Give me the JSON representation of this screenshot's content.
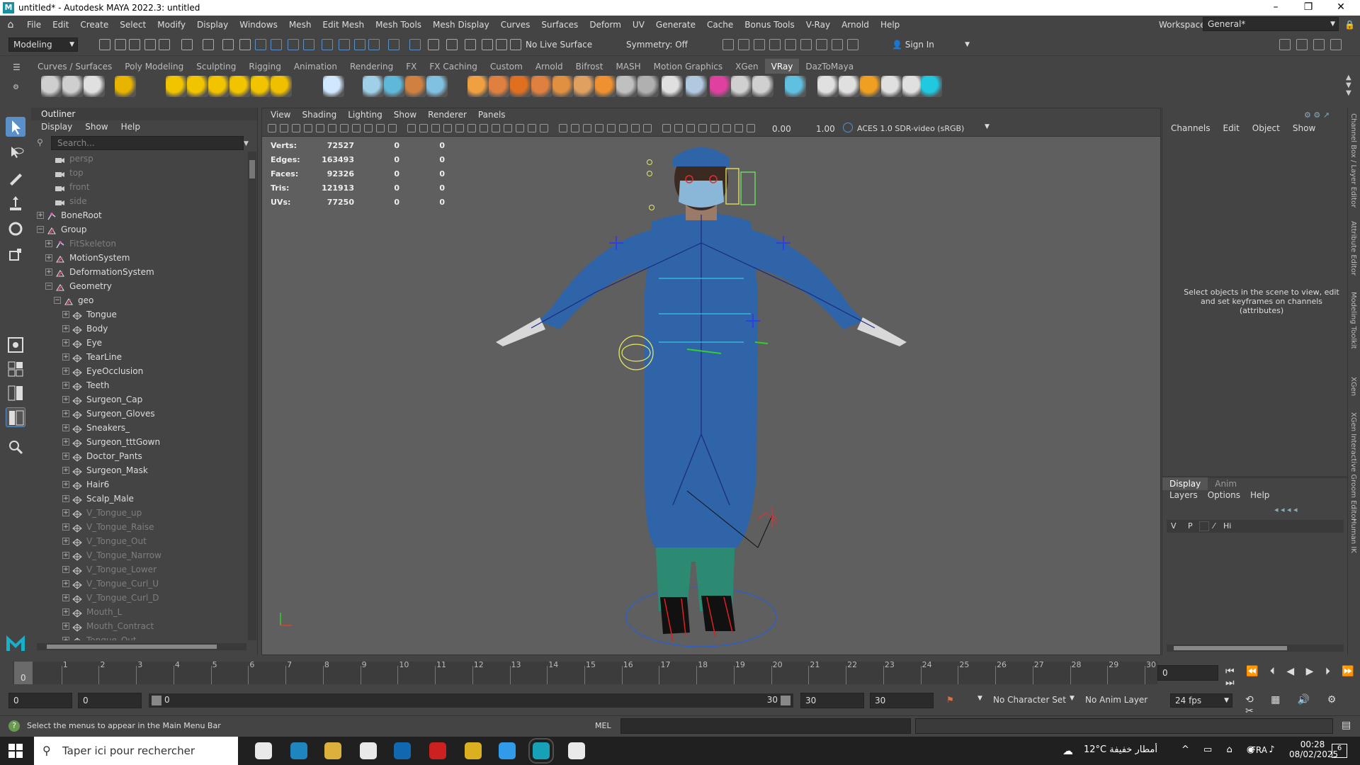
{
  "window": {
    "title": "untitled* - Autodesk MAYA 2022.3: untitled",
    "controls": [
      "–",
      "❐",
      "✕"
    ]
  },
  "menubar": {
    "items": [
      "File",
      "Edit",
      "Create",
      "Select",
      "Modify",
      "Display",
      "Windows",
      "Mesh",
      "Edit Mesh",
      "Mesh Tools",
      "Mesh Display",
      "Curves",
      "Surfaces",
      "Deform",
      "UV",
      "Generate",
      "Cache",
      "Bonus Tools",
      "V-Ray",
      "Arnold",
      "Help"
    ],
    "workspace_label": "Workspace:",
    "workspace_value": "General*"
  },
  "toolbar": {
    "mode": "Modeling",
    "live_surface": "No Live Surface",
    "symmetry": "Symmetry: Off",
    "sign_in": "Sign In"
  },
  "shelf": {
    "tabs": [
      "Curves / Surfaces",
      "Poly Modeling",
      "Sculpting",
      "Rigging",
      "Animation",
      "Rendering",
      "FX",
      "FX Caching",
      "Custom",
      "Arnold",
      "Bifrost",
      "MASH",
      "Motion Graphics",
      "XGen",
      "VRay",
      "DazToMaya"
    ],
    "active_tab": "VRay",
    "icon_colors": [
      "#cfcfcf",
      "#cfcfcf",
      "#e0e0e0",
      "#e8b400",
      "#f2c400",
      "#f2c400",
      "#f2c400",
      "#f2c400",
      "#f2c400",
      "#f0c000",
      "#d0e8ff",
      "#a0d0e8",
      "#60b8d8",
      "#d08040",
      "#80c0e0",
      "#f0a040",
      "#e08040",
      "#e07020",
      "#e08040",
      "#e09040",
      "#e0a060",
      "#f09030",
      "#c0c0c0",
      "#b0b0b0",
      "#e0e0e0",
      "#b0c8e0",
      "#e040a0",
      "#d0d0d0",
      "#d0d0d0",
      "#60c0e0",
      "#e0e0e0",
      "#e0e0e0",
      "#f0a020",
      "#e0e0e0",
      "#e0e0e0",
      "#20c8e0"
    ]
  },
  "outliner": {
    "title": "Outliner",
    "menus": [
      "Display",
      "Show",
      "Help"
    ],
    "search_placeholder": "Search...",
    "items": [
      {
        "label": "persp",
        "level": 1,
        "dim": true,
        "icon": "camera-icon",
        "expand": ""
      },
      {
        "label": "top",
        "level": 1,
        "dim": true,
        "icon": "camera-icon",
        "expand": ""
      },
      {
        "label": "front",
        "level": 1,
        "dim": true,
        "icon": "camera-icon",
        "expand": ""
      },
      {
        "label": "side",
        "level": 1,
        "dim": true,
        "icon": "camera-icon",
        "expand": ""
      },
      {
        "label": "BoneRoot",
        "level": 0,
        "dim": false,
        "icon": "joint-icon",
        "expand": "+"
      },
      {
        "label": "Group",
        "level": 0,
        "dim": false,
        "icon": "group-icon",
        "expand": "−"
      },
      {
        "label": "FitSkeleton",
        "level": 1,
        "dim": true,
        "icon": "joint-icon",
        "expand": "+"
      },
      {
        "label": "MotionSystem",
        "level": 1,
        "dim": false,
        "icon": "group-icon",
        "expand": "+"
      },
      {
        "label": "DeformationSystem",
        "level": 1,
        "dim": false,
        "icon": "group-icon",
        "expand": "+"
      },
      {
        "label": "Geometry",
        "level": 1,
        "dim": false,
        "icon": "group-icon",
        "expand": "−"
      },
      {
        "label": "geo",
        "level": 2,
        "dim": false,
        "icon": "group-icon",
        "expand": "−"
      },
      {
        "label": "Tongue",
        "level": 3,
        "dim": false,
        "icon": "mesh-icon",
        "expand": "+"
      },
      {
        "label": "Body",
        "level": 3,
        "dim": false,
        "icon": "mesh-icon",
        "expand": "+"
      },
      {
        "label": "Eye",
        "level": 3,
        "dim": false,
        "icon": "mesh-icon",
        "expand": "+"
      },
      {
        "label": "TearLine",
        "level": 3,
        "dim": false,
        "icon": "mesh-icon",
        "expand": "+"
      },
      {
        "label": "EyeOcclusion",
        "level": 3,
        "dim": false,
        "icon": "mesh-icon",
        "expand": "+"
      },
      {
        "label": "Teeth",
        "level": 3,
        "dim": false,
        "icon": "mesh-icon",
        "expand": "+"
      },
      {
        "label": "Surgeon_Cap",
        "level": 3,
        "dim": false,
        "icon": "mesh-icon",
        "expand": "+"
      },
      {
        "label": "Surgeon_Gloves",
        "level": 3,
        "dim": false,
        "icon": "mesh-icon",
        "expand": "+"
      },
      {
        "label": "Sneakers_",
        "level": 3,
        "dim": false,
        "icon": "mesh-icon",
        "expand": "+"
      },
      {
        "label": "Surgeon_tttGown",
        "level": 3,
        "dim": false,
        "icon": "mesh-icon",
        "expand": "+"
      },
      {
        "label": "Doctor_Pants",
        "level": 3,
        "dim": false,
        "icon": "mesh-icon",
        "expand": "+"
      },
      {
        "label": "Surgeon_Mask",
        "level": 3,
        "dim": false,
        "icon": "mesh-icon",
        "expand": "+"
      },
      {
        "label": "Hair6",
        "level": 3,
        "dim": false,
        "icon": "mesh-icon",
        "expand": "+"
      },
      {
        "label": "Scalp_Male",
        "level": 3,
        "dim": false,
        "icon": "mesh-icon",
        "expand": "+"
      },
      {
        "label": "V_Tongue_up",
        "level": 3,
        "dim": true,
        "icon": "mesh-icon",
        "expand": "+"
      },
      {
        "label": "V_Tongue_Raise",
        "level": 3,
        "dim": true,
        "icon": "mesh-icon",
        "expand": "+"
      },
      {
        "label": "V_Tongue_Out",
        "level": 3,
        "dim": true,
        "icon": "mesh-icon",
        "expand": "+"
      },
      {
        "label": "V_Tongue_Narrow",
        "level": 3,
        "dim": true,
        "icon": "mesh-icon",
        "expand": "+"
      },
      {
        "label": "V_Tongue_Lower",
        "level": 3,
        "dim": true,
        "icon": "mesh-icon",
        "expand": "+"
      },
      {
        "label": "V_Tongue_Curl_U",
        "level": 3,
        "dim": true,
        "icon": "mesh-icon",
        "expand": "+"
      },
      {
        "label": "V_Tongue_Curl_D",
        "level": 3,
        "dim": true,
        "icon": "mesh-icon",
        "expand": "+"
      },
      {
        "label": "Mouth_L",
        "level": 3,
        "dim": true,
        "icon": "mesh-icon",
        "expand": "+"
      },
      {
        "label": "Mouth_Contract",
        "level": 3,
        "dim": true,
        "icon": "mesh-icon",
        "expand": "+"
      },
      {
        "label": "Tongue_Out",
        "level": 3,
        "dim": true,
        "icon": "mesh-icon",
        "expand": "+"
      }
    ]
  },
  "viewport": {
    "menus": [
      "View",
      "Shading",
      "Lighting",
      "Show",
      "Renderer",
      "Panels"
    ],
    "exposure": "0.00",
    "gamma": "1.00",
    "color_space": "ACES 1.0 SDR-video (sRGB)",
    "stats": [
      {
        "label": "Verts:",
        "v1": "72527",
        "v2": "0",
        "v3": "0"
      },
      {
        "label": "Edges:",
        "v1": "163493",
        "v2": "0",
        "v3": "0"
      },
      {
        "label": "Faces:",
        "v1": "92326",
        "v2": "0",
        "v3": "0"
      },
      {
        "label": "Tris:",
        "v1": "121913",
        "v2": "0",
        "v3": "0"
      },
      {
        "label": "UVs:",
        "v1": "77250",
        "v2": "0",
        "v3": "0"
      }
    ]
  },
  "channelbox": {
    "menus": [
      "Channels",
      "Edit",
      "Object",
      "Show"
    ],
    "hint": "Select objects in the scene to view, edit and set keyframes on channels (attributes)",
    "layer_tabs": [
      "Display",
      "Anim"
    ],
    "layer_menus": [
      "Layers",
      "Options",
      "Help"
    ],
    "layer_cols": [
      "V",
      "P",
      "",
      "Hi"
    ]
  },
  "sidestrip": {
    "labels": [
      "Channel Box / Layer Editor",
      "Attribute Editor",
      "Modeling Toolkit",
      "XGen",
      "XGen Interactive Groom Editor",
      "Human IK"
    ]
  },
  "timeline": {
    "ticks": [
      "0",
      "1",
      "2",
      "3",
      "4",
      "5",
      "6",
      "7",
      "8",
      "9",
      "10",
      "11",
      "12",
      "13",
      "14",
      "15",
      "16",
      "17",
      "18",
      "19",
      "20",
      "21",
      "22",
      "23",
      "24",
      "25",
      "26",
      "27",
      "28",
      "29",
      "30"
    ],
    "current_frame": "0",
    "frame_field": "0"
  },
  "range": {
    "start": "0",
    "start2": "0",
    "slider_start": "0",
    "slider_end": "30",
    "end": "30",
    "end2": "30",
    "character_set": "No Character Set",
    "anim_layer": "No Anim Layer",
    "fps": "24 fps"
  },
  "cmdline": {
    "help": "Select the menus to appear in the Main Menu Bar",
    "lang": "MEL"
  },
  "taskbar": {
    "search_placeholder": "Taper ici pour rechercher",
    "weather": "12°C  أمطار خفيفة",
    "lang": "FRA",
    "time": "00:28",
    "date": "08/02/2025",
    "notif": "6"
  },
  "colors": {
    "bg": "#444444",
    "viewport": "#5f5f5f",
    "accent": "#5a8fc8",
    "gown": "#2f64a8",
    "pants": "#2c8a72"
  }
}
